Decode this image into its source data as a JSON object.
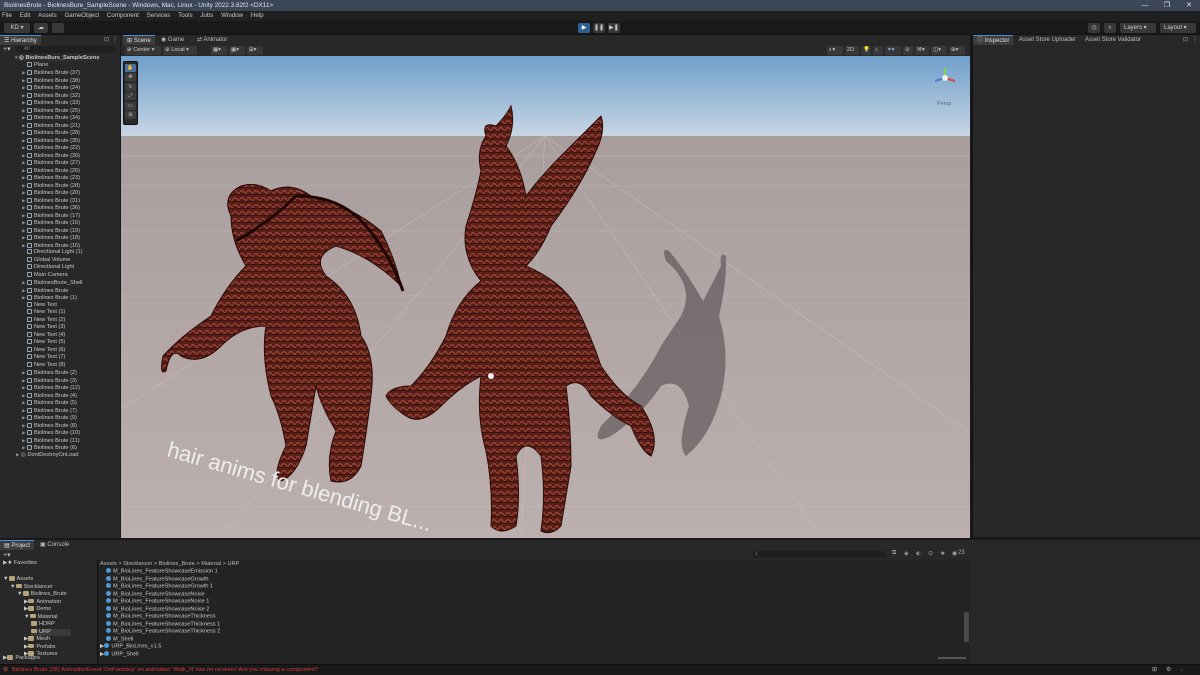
{
  "window": {
    "title": "BiolinesBrute - BiolinesBure_SampleScene - Windows, Mac, Linux - Unity 2022.3.62f2 <DX11>",
    "controls": [
      "—",
      "❐",
      "✕"
    ]
  },
  "menu": [
    "File",
    "Edit",
    "Assets",
    "GameObject",
    "Component",
    "Services",
    "Tools",
    "Jobs",
    "Window",
    "Help"
  ],
  "toolbar": {
    "account": "KD ▾",
    "layers": "Layers",
    "layout": "Layout"
  },
  "hierarchy": {
    "tab": "Hierarchy",
    "search_placeholder": "All",
    "scene_name": "BiolinesBure_SampleScene",
    "items": [
      {
        "label": "Plane",
        "exp": false
      },
      {
        "label": "Biolines Brute (37)",
        "exp": true
      },
      {
        "label": "Biolines Brute (38)",
        "exp": true
      },
      {
        "label": "Biolines Brute (24)",
        "exp": true
      },
      {
        "label": "Biolines Brute (32)",
        "exp": true
      },
      {
        "label": "Biolines Brute (33)",
        "exp": true
      },
      {
        "label": "Biolines Brute (25)",
        "exp": true
      },
      {
        "label": "Biolines Brute (34)",
        "exp": true
      },
      {
        "label": "Biolines Brute (21)",
        "exp": true
      },
      {
        "label": "Biolines Brute (28)",
        "exp": true
      },
      {
        "label": "Biolines Brute (35)",
        "exp": true
      },
      {
        "label": "Biolines Brute (22)",
        "exp": true
      },
      {
        "label": "Biolines Brute (30)",
        "exp": true
      },
      {
        "label": "Biolines Brute (27)",
        "exp": true
      },
      {
        "label": "Biolines Brute (26)",
        "exp": true
      },
      {
        "label": "Biolines Brute (23)",
        "exp": true
      },
      {
        "label": "Biolines Brute (28)",
        "exp": true
      },
      {
        "label": "Biolines Brute (20)",
        "exp": true
      },
      {
        "label": "Biolines Brute (31)",
        "exp": true
      },
      {
        "label": "Biolines Brute (36)",
        "exp": true
      },
      {
        "label": "Biolines Brute (17)",
        "exp": true
      },
      {
        "label": "Biolines Brute (16)",
        "exp": true
      },
      {
        "label": "Biolines Brute (19)",
        "exp": true
      },
      {
        "label": "Biolines Brute (18)",
        "exp": true
      },
      {
        "label": "Biolines Brute (15)",
        "exp": true
      },
      {
        "label": "Directional Light (1)",
        "exp": false
      },
      {
        "label": "Global Volume",
        "exp": false
      },
      {
        "label": "Directional Light",
        "exp": false
      },
      {
        "label": "Main Camera",
        "exp": false
      },
      {
        "label": "BiolinesBrute_Shell",
        "exp": true
      },
      {
        "label": "Biolines Brute",
        "exp": true
      },
      {
        "label": "Biolines Brute (1)",
        "exp": true
      },
      {
        "label": "New Text",
        "exp": false
      },
      {
        "label": "New Text (1)",
        "exp": false
      },
      {
        "label": "New Text (2)",
        "exp": false
      },
      {
        "label": "New Text (3)",
        "exp": false
      },
      {
        "label": "New Text (4)",
        "exp": false
      },
      {
        "label": "New Text (5)",
        "exp": false
      },
      {
        "label": "New Text (6)",
        "exp": false
      },
      {
        "label": "New Text (7)",
        "exp": false
      },
      {
        "label": "New Text (8)",
        "exp": false
      },
      {
        "label": "Biolines Brute (2)",
        "exp": true
      },
      {
        "label": "Biolines Brute (3)",
        "exp": true
      },
      {
        "label": "Biolines Brute (12)",
        "exp": true
      },
      {
        "label": "Biolines Brute (4)",
        "exp": true
      },
      {
        "label": "Biolines Brute (5)",
        "exp": true
      },
      {
        "label": "Biolines Brute (7)",
        "exp": true
      },
      {
        "label": "Biolines Brute (9)",
        "exp": true
      },
      {
        "label": "Biolines Brute (8)",
        "exp": true
      },
      {
        "label": "Biolines Brute (10)",
        "exp": true
      },
      {
        "label": "Biolines Brute (11)",
        "exp": true
      },
      {
        "label": "Biolines Brute (6)",
        "exp": true
      }
    ],
    "dont_destroy": "DontDestroyOnLoad"
  },
  "scene_tabs": [
    "Scene",
    "Game",
    "Animator"
  ],
  "scene_toolbar": {
    "pivot": "Center ▾",
    "space": "Local ▾",
    "mode_2d": "2D",
    "persp": "Persp",
    "world_text": "hair anims for blending BL..."
  },
  "inspector_tabs": [
    "Inspector",
    "Asset Store Uploader",
    "Asset Store Validator"
  ],
  "project": {
    "tabs": [
      "Project",
      "Console"
    ],
    "favorites": "Favorites",
    "tree": [
      {
        "label": "Assets",
        "depth": 0
      },
      {
        "label": "Stocklancer",
        "depth": 1
      },
      {
        "label": "Biolines_Brute",
        "depth": 2
      },
      {
        "label": "Animation",
        "depth": 3
      },
      {
        "label": "Demo",
        "depth": 3
      },
      {
        "label": "Material",
        "depth": 3
      },
      {
        "label": "HDRP",
        "depth": 4
      },
      {
        "label": "URP",
        "depth": 4
      },
      {
        "label": "Mesh",
        "depth": 3
      },
      {
        "label": "Prefabs",
        "depth": 3
      },
      {
        "label": "Textures",
        "depth": 3
      }
    ],
    "packages": "Packages",
    "breadcrumb": "Assets > Stocklancer > Biolines_Brute > Material > URP",
    "files": [
      "M_BioLines_FeatureShowcaseEmission 1",
      "M_BioLines_FeatureShowcaseGrowth",
      "M_BioLines_FeatureShowcaseGrowth 1",
      "M_BioLines_FeatureShowcaseNoise",
      "M_BioLines_FeatureShowcaseNoise 1",
      "M_BioLines_FeatureShowcaseNoise 2",
      "M_BioLines_FeatureShowcaseThickness",
      "M_BioLines_FeatureShowcaseThickness 1",
      "M_BioLines_FeatureShowcaseThickness 2",
      "M_Shell",
      "URP_BioLines_v1.5",
      "URP_Shell"
    ],
    "count": "23"
  },
  "status": {
    "message": "Biolines Brute (28) AnimationEvent 'OnFootstep' on animation 'Walk_N' has no receiver! Are you missing a component?",
    "error_color": "#d23c3c"
  }
}
